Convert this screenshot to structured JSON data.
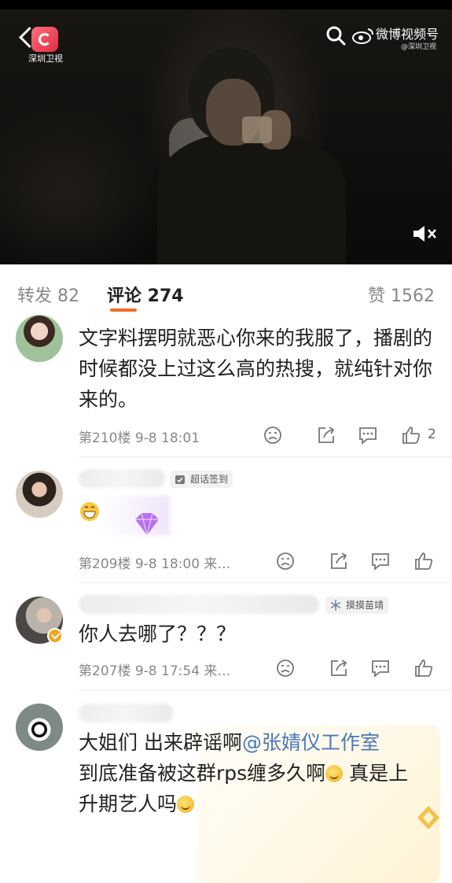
{
  "video": {
    "station": "深圳卫视",
    "channel": "微博视频号",
    "channel_sub": "@深圳卫视"
  },
  "tabs": {
    "repost": "转发 82",
    "comment": "评论 274",
    "like": "赞 1562"
  },
  "comments": [
    {
      "text": "文字料摆明就恶心你来的我服了，播剧的时候都没上过这么高的热搜，就纯针对你来的。",
      "meta": "第210楼  9-8 18:01",
      "likes": "2"
    },
    {
      "tag": "超话签到",
      "meta": "第209楼  9-8 18:00  来…"
    },
    {
      "tag": "摸摸苗靖",
      "text": "你人去哪了？？？",
      "meta": "第207楼  9-8 17:54  来…"
    },
    {
      "text_a": "大姐们 出来辟谣啊",
      "mention": "@张婧仪工作室",
      "text_b": "到底准备被这群rps缠多久啊",
      "text_c": " 真是上升期艺人吗"
    }
  ],
  "colors": {
    "accent": "#f26d22",
    "mention": "#4a78b8",
    "brand": "#e22b3f"
  }
}
